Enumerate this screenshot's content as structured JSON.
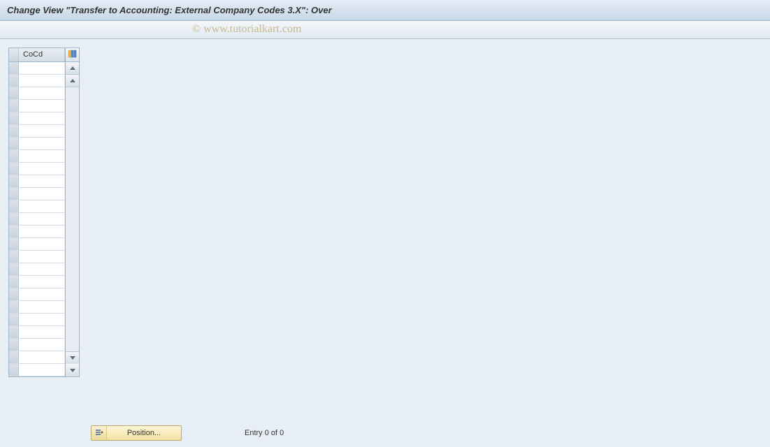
{
  "header": {
    "title": "Change View \"Transfer to Accounting: External Company Codes 3.X\": Over"
  },
  "watermark": "© www.tutorialkart.com",
  "table": {
    "column_header": "CoCd",
    "row_count": 25
  },
  "footer": {
    "position_label": "Position...",
    "entry_text": "Entry 0 of 0"
  }
}
